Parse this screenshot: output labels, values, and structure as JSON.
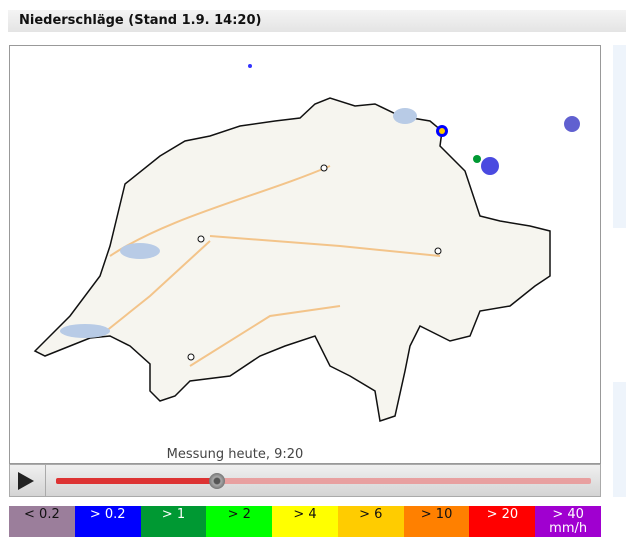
{
  "header": {
    "title": "Niederschläge (Stand 1.9. 14:20)"
  },
  "map": {
    "caption": "Messung heute, 9:20"
  },
  "player": {
    "progress": 0.3
  },
  "legend": [
    {
      "label": "< 0.2",
      "color": "#9b7e9b",
      "text": "#111"
    },
    {
      "label": "> 0.2",
      "color": "#0000ff",
      "text": "#fff"
    },
    {
      "label": "> 1",
      "color": "#009933",
      "text": "#fff"
    },
    {
      "label": "> 2",
      "color": "#00ff00",
      "text": "#111"
    },
    {
      "label": "> 4",
      "color": "#ffff00",
      "text": "#111"
    },
    {
      "label": "> 6",
      "color": "#ffcc00",
      "text": "#111"
    },
    {
      "label": "> 10",
      "color": "#ff8000",
      "text": "#111"
    },
    {
      "label": "> 20",
      "color": "#ff0000",
      "text": "#fff"
    },
    {
      "label": "> 40",
      "unit": "mm/h",
      "color": "#a000d0",
      "text": "#fff"
    }
  ]
}
